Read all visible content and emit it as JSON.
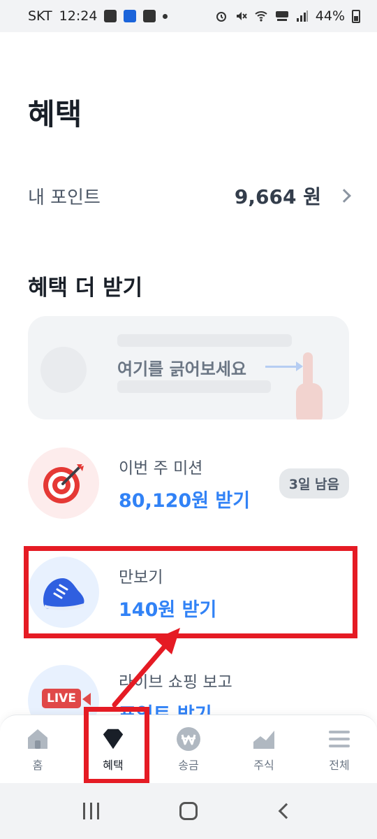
{
  "status_bar": {
    "carrier": "SKT",
    "time": "12:24",
    "battery": "44%",
    "icons": [
      "call-forward-icon",
      "app-notification-icon",
      "calendar-icon",
      "dot-icon",
      "alarm-icon",
      "mute-icon",
      "wifi-icon",
      "hd-voice-icon",
      "signal-icon",
      "battery-icon"
    ]
  },
  "page": {
    "title": "혜택"
  },
  "points": {
    "label": "내 포인트",
    "value": "9,664 원"
  },
  "section": {
    "title": "혜택 더 받기"
  },
  "scratch_card": {
    "text": "여기를 긁어보세요"
  },
  "benefits": [
    {
      "title": "이번 주 미션",
      "reward": "80,120원 받기",
      "badge": "3일 남음",
      "icon": "dart-target-icon"
    },
    {
      "title": "만보기",
      "reward": "140원 받기",
      "icon": "sneaker-icon"
    },
    {
      "title": "라이브 쇼핑 보고",
      "reward": "포인트 받기",
      "icon": "live-camera-icon",
      "icon_label": "LIVE"
    }
  ],
  "tab_bar": {
    "tabs": [
      {
        "label": "홈",
        "icon": "home-icon"
      },
      {
        "label": "혜택",
        "icon": "diamond-icon",
        "active": true
      },
      {
        "label": "송금",
        "icon": "won-icon"
      },
      {
        "label": "주식",
        "icon": "chart-icon"
      },
      {
        "label": "전체",
        "icon": "menu-icon"
      }
    ]
  },
  "colors": {
    "accent_blue": "#3182f6",
    "annotation_red": "#e51b24",
    "text_primary": "#191f28",
    "text_secondary": "#4e5968"
  }
}
